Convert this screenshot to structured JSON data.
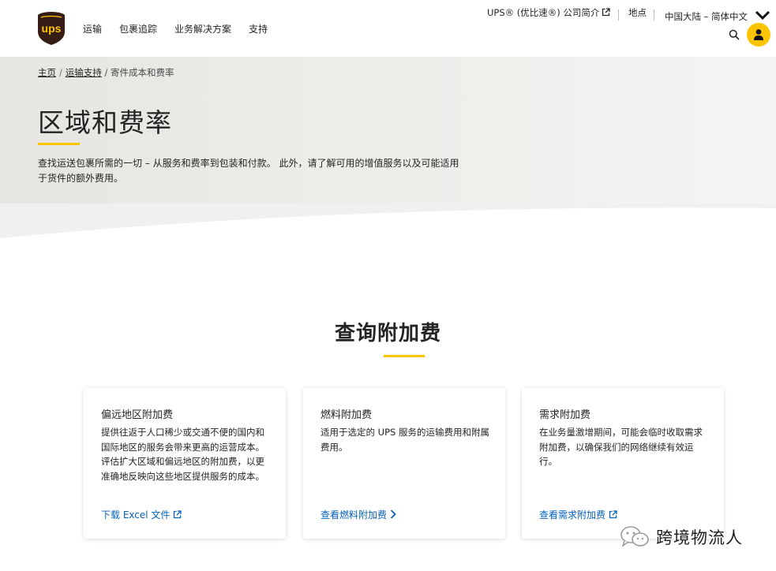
{
  "colors": {
    "brand_brown": "#351c15",
    "brand_gold": "#ffc400",
    "link_blue": "#0662bb",
    "text": "#242424"
  },
  "header": {
    "logo_text": "ups",
    "nav": [
      "运输",
      "包裹追踪",
      "业务解决方案",
      "支持"
    ],
    "utility": {
      "about_label": "UPS® (优比速®) 公司简介",
      "locations_label": "地点",
      "language_label": "中国大陆 – 简体中文"
    },
    "icons": {
      "search": "search-icon",
      "account": "user-icon",
      "language": "chevron-down-icon",
      "external": "external-link-icon"
    }
  },
  "breadcrumb": {
    "home": "主页",
    "sep": "/",
    "shipping_support": "运输支持",
    "current": "/ 寄件成本和费率"
  },
  "hero": {
    "title": "区域和费率",
    "description": "查找运送包裹所需的一切 – 从服务和费率到包装和付款。 此外，请了解可用的增值服务以及可能适用于货件的额外费用。"
  },
  "surcharges": {
    "heading": "查询附加费",
    "cards": [
      {
        "title": "偏远地区附加费",
        "description": "提供往返于人口稀少或交通不便的国内和国际地区的服务会带来更高的运营成本。 评估扩大区域和偏远地区的附加费，以更准确地反映向这些地区提供服务的成本。",
        "link": "下载 Excel 文件",
        "link_icon": "external-link-icon"
      },
      {
        "title": "燃料附加费",
        "description": "适用于选定的 UPS 服务的运输费用和附属费用。",
        "link": "查看燃料附加费",
        "link_icon": "chevron-right-icon"
      },
      {
        "title": "需求附加费",
        "description": "在业务量激增期间，可能会临时收取需求附加费，以确保我们的网络继续有效运行。",
        "link": "查看需求附加费",
        "link_icon": "external-link-icon"
      }
    ]
  },
  "watermark": {
    "text": "跨境物流人",
    "icon": "wechat-icon"
  }
}
